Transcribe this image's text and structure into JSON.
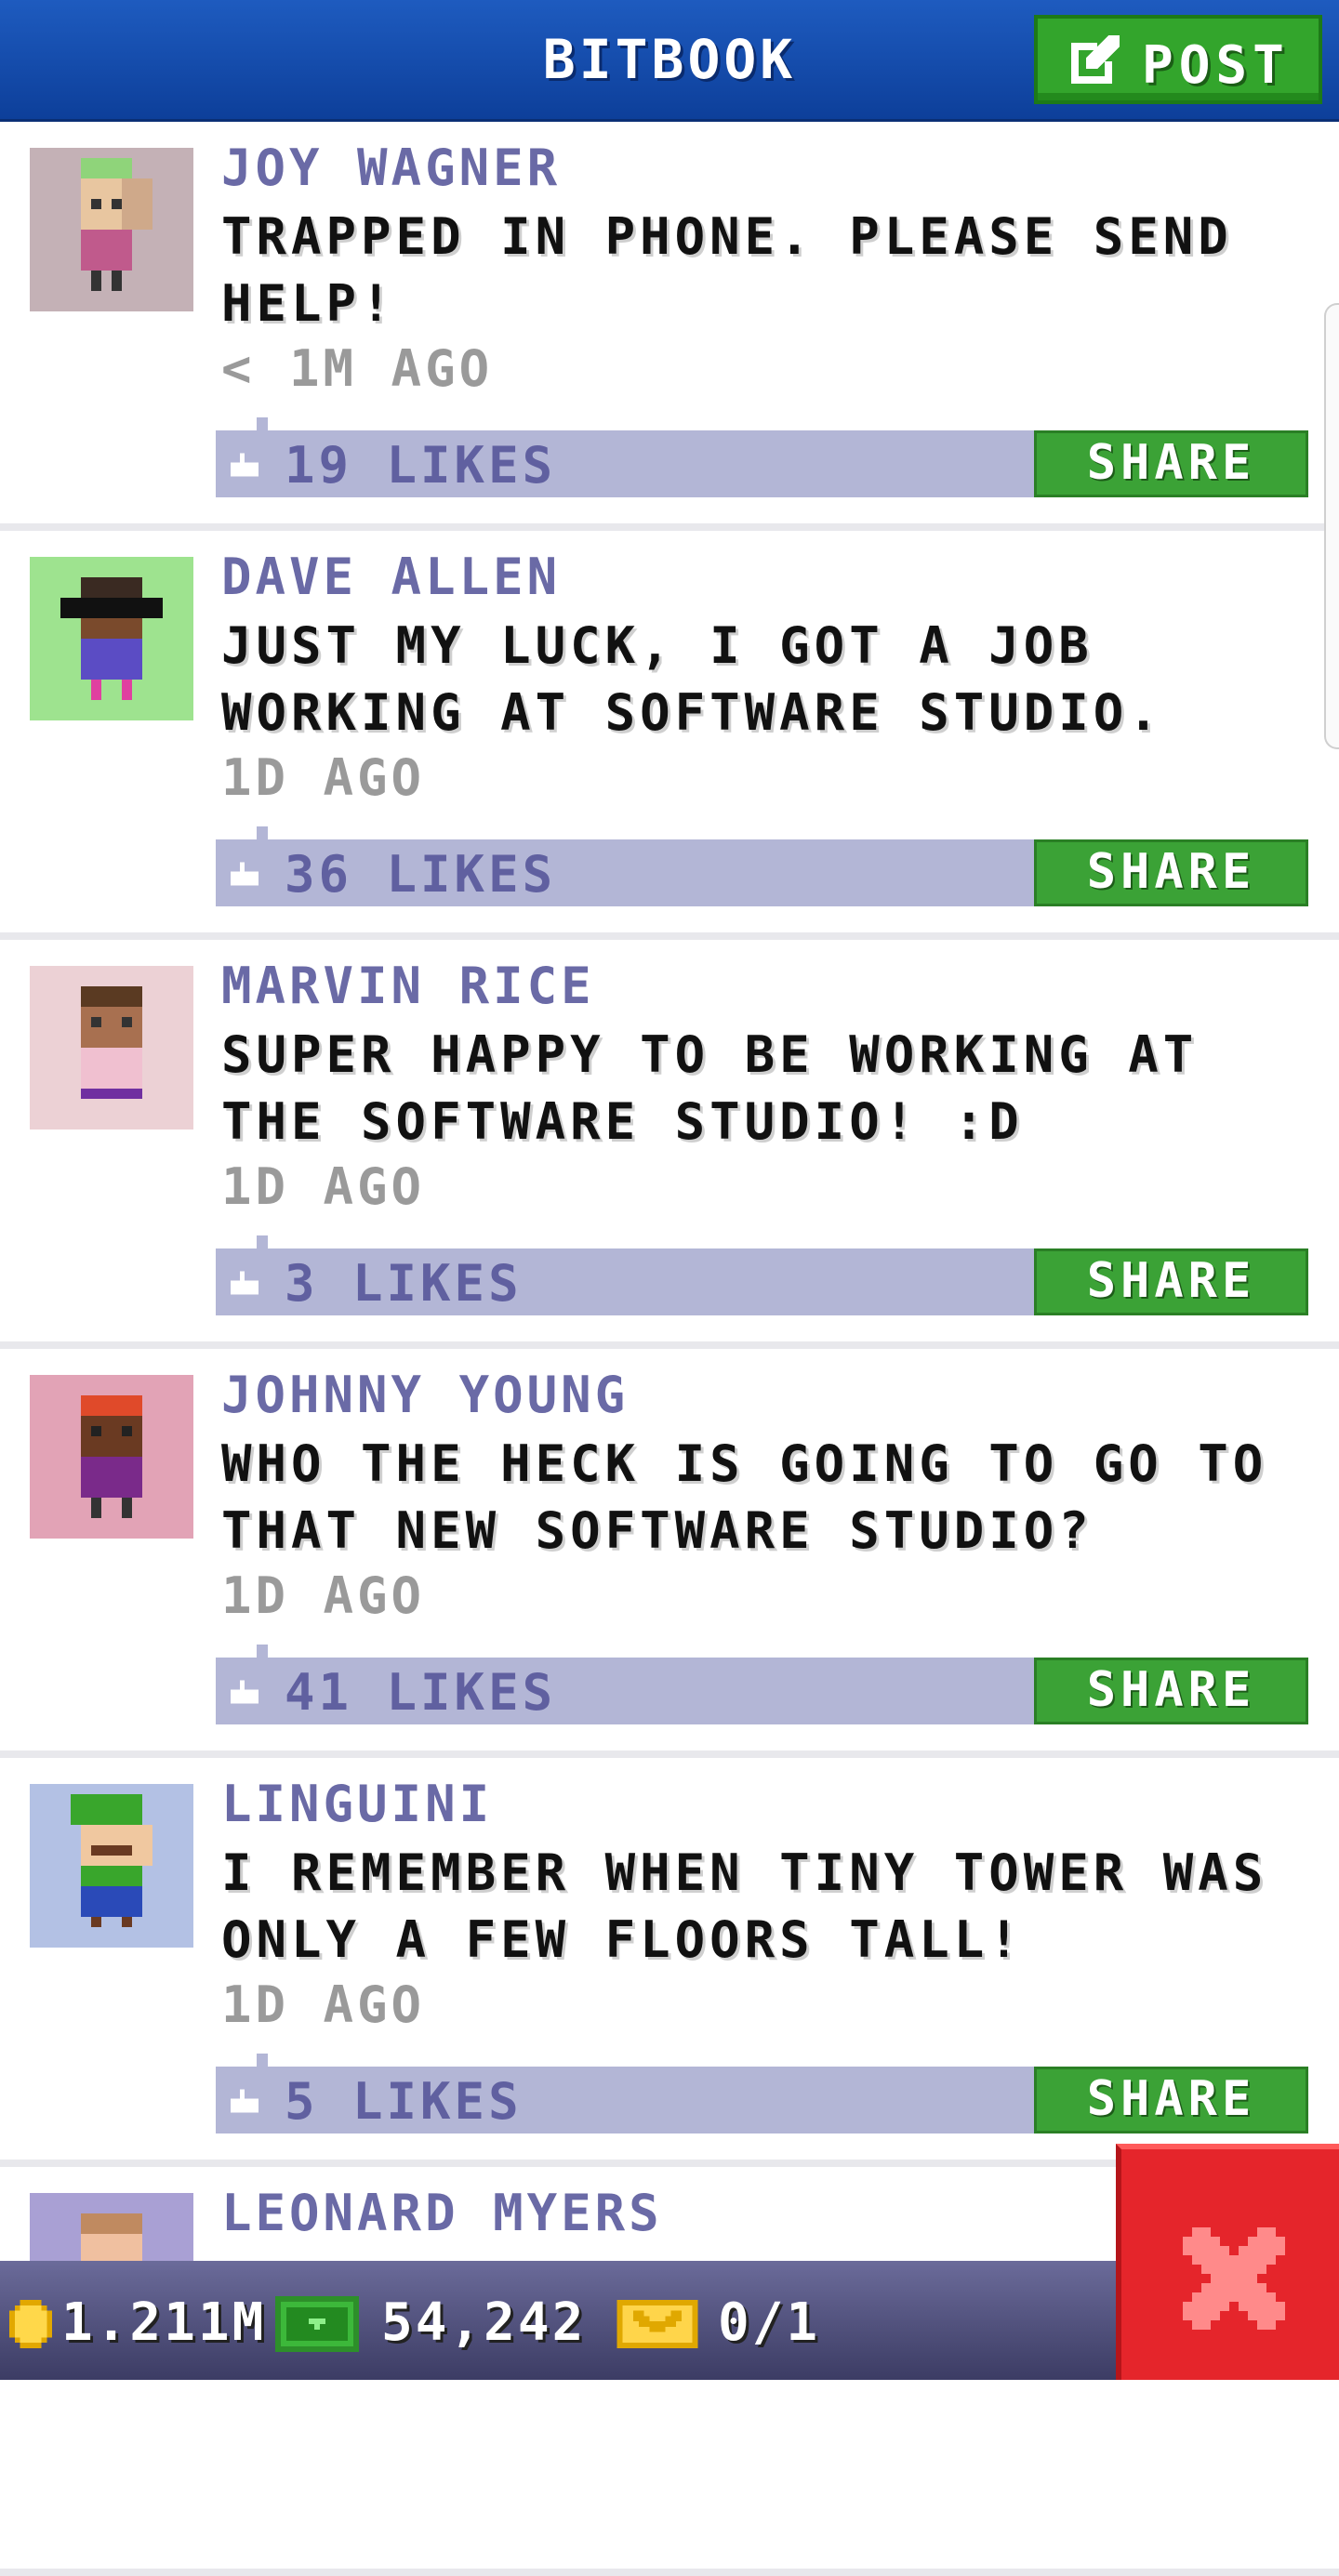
{
  "header": {
    "title": "BITBOOK",
    "post_label": "POST"
  },
  "posts": [
    {
      "author": "JOY WAGNER",
      "message": "TRAPPED IN PHONE. PLEASE SEND HELP!",
      "time": "< 1M AGO",
      "likes": "19 LIKES",
      "share": "SHARE",
      "avatar_bg": "#c4b1b6"
    },
    {
      "author": "DAVE ALLEN",
      "message": "JUST MY LUCK, I GOT A JOB WORKING AT SOFTWARE STUDIO.",
      "time": "1D AGO",
      "likes": "36 LIKES",
      "share": "SHARE",
      "avatar_bg": "#9ee38f"
    },
    {
      "author": "MARVIN RICE",
      "message": "SUPER HAPPY TO BE WORKING AT THE SOFTWARE STUDIO! :D",
      "time": "1D AGO",
      "likes": "3 LIKES",
      "share": "SHARE",
      "avatar_bg": "#ecd1d5"
    },
    {
      "author": "JOHNNY YOUNG",
      "message": "WHO THE HECK IS GOING TO GO TO THAT NEW SOFTWARE STUDIO?",
      "time": "1D AGO",
      "likes": "41 LIKES",
      "share": "SHARE",
      "avatar_bg": "#e2a3b6"
    },
    {
      "author": "LINGUINI",
      "message": "I REMEMBER WHEN TINY TOWER WAS ONLY A FEW FLOORS TALL!",
      "time": "1D AGO",
      "likes": "5 LIKES",
      "share": "SHARE",
      "avatar_bg": "#b3c1e4"
    },
    {
      "author": "LEONARD MYERS",
      "message": "",
      "time": "",
      "likes": "",
      "share": "",
      "avatar_bg": "#a9a0d4"
    }
  ],
  "footer": {
    "coins": "1.211M",
    "bux": "54,242",
    "tickets": "0/1"
  },
  "colors": {
    "header_blue": "#1e5bbf",
    "share_green": "#3ba236",
    "likebar": "#b3b6d6",
    "author": "#6a6aa6",
    "close_red": "#e5252b"
  }
}
